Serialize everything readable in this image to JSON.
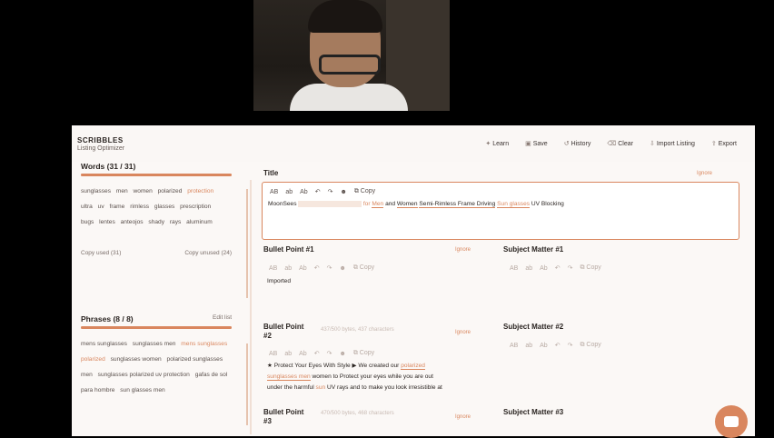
{
  "app": {
    "brand": "SCRIBBLES",
    "subtitle": "Listing Optimizer",
    "actions": [
      {
        "label": "Learn",
        "icon": "lightbulb-icon"
      },
      {
        "label": "Save",
        "icon": "save-icon"
      },
      {
        "label": "History",
        "icon": "history-icon"
      },
      {
        "label": "Clear",
        "icon": "clear-icon"
      },
      {
        "label": "Import Listing",
        "icon": "import-icon"
      },
      {
        "label": "Export",
        "icon": "export-icon"
      }
    ]
  },
  "words": {
    "title": "Words (31 / 31)",
    "items": [
      "sunglasses",
      "men",
      "women",
      "polarized",
      "protection",
      "ultra",
      "uv",
      "frame",
      "rimless",
      "glasses",
      "prescription",
      "bugs",
      "lentes",
      "anteojos",
      "shady",
      "rays",
      "aluminum"
    ],
    "copy_used": "Copy used (31)",
    "copy_unused": "Copy unused (24)"
  },
  "phrases": {
    "title": "Phrases (8 / 8)",
    "edit": "Edit list",
    "items": [
      "mens sunglasses",
      "sunglasses men",
      "mens sunglasses polarized",
      "sunglasses women",
      "polarized sunglasses men",
      "sunglasses polarized uv protection",
      "gafas de sol para hombre",
      "sun glasses men"
    ]
  },
  "title_field": {
    "label": "Title",
    "ignore": "Ignore",
    "copy": "Copy",
    "text_parts": [
      "MoonSees",
      "for",
      "Men",
      "and",
      "Women",
      "Semi-Rimless Frame Driving",
      "Sun glasses",
      "UV Blocking"
    ]
  },
  "bullet1": {
    "label": "Bullet Point #1",
    "ignore": "Ignore",
    "copy": "Copy",
    "text": "Imported"
  },
  "bullet2": {
    "label": "Bullet Point",
    "label2": "#2",
    "meta": "437/500 bytes, 437 characters",
    "ignore": "Ignore",
    "copy": "Copy",
    "line1_a": "★ Protect Your Eyes With Style ▶ We created our",
    "line1_b": "polarized",
    "line2_a": "sunglasses men",
    "line2_b": "women to Protect your eyes while you are out",
    "line3_a": "under the harmful",
    "line3_b": "sun",
    "line3_c": "UV rays and to make you look irresistible at"
  },
  "bullet3": {
    "label": "Bullet Point",
    "label2": "#3",
    "meta": "470/500 bytes, 468 characters",
    "ignore": "Ignore"
  },
  "subject1": {
    "label": "Subject Matter #1",
    "copy": "Copy"
  },
  "subject2": {
    "label": "Subject Matter #2",
    "copy": "Copy"
  },
  "subject3": {
    "label": "Subject Matter #3"
  },
  "colors": {
    "accent": "#d9865e",
    "bg": "#fbf8f6"
  }
}
